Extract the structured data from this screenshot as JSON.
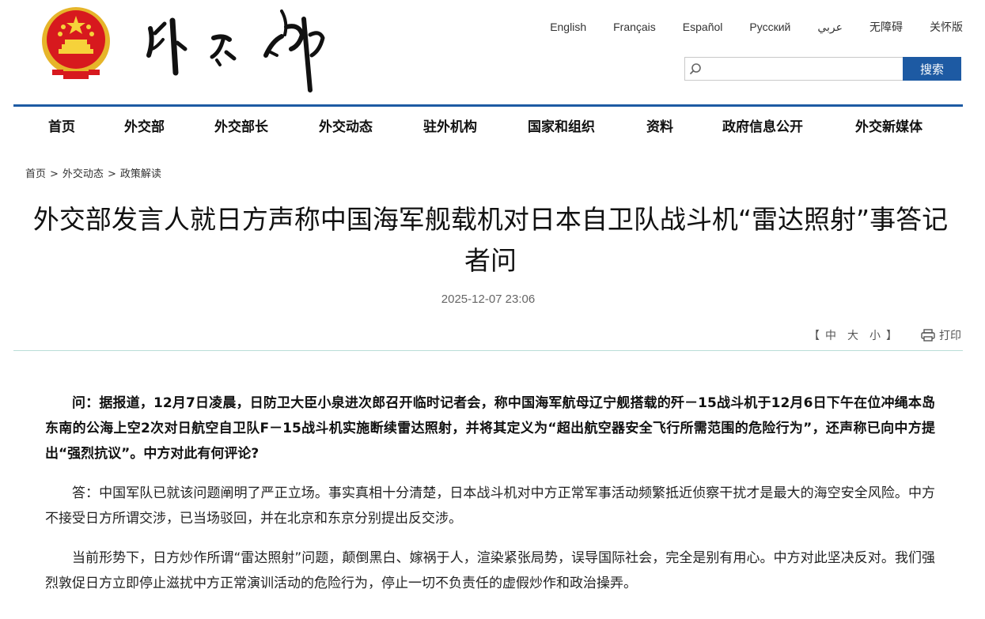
{
  "header": {
    "languages": [
      "English",
      "Français",
      "Español",
      "Русский",
      "عربي",
      "无障碍",
      "关怀版"
    ],
    "search": {
      "placeholder": "",
      "button_label": "搜索"
    }
  },
  "nav": {
    "items": [
      "首页",
      "外交部",
      "外交部长",
      "外交动态",
      "驻外机构",
      "国家和组织",
      "资料",
      "政府信息公开",
      "外交新媒体"
    ]
  },
  "breadcrumb": [
    "首页",
    "外交动态",
    "政策解读"
  ],
  "breadcrumb_sep": ">",
  "article": {
    "title": "外交部发言人就日方声称中国海军舰载机对日本自卫队战斗机“雷达照射”事答记者问",
    "date": "2025-12-07 23:06",
    "font_size": {
      "open": "【",
      "large": "中",
      "medium": "大",
      "small": "小",
      "close": "】"
    },
    "print_label": "打印",
    "paragraphs": [
      "问：据报道，12月7日凌晨，日防卫大臣小泉进次郎召开临时记者会，称中国海军航母辽宁舰搭载的歼－15战斗机于12月6日下午在位冲绳本岛东南的公海上空2次对日航空自卫队F－15战斗机实施断续雷达照射，并将其定义为“超出航空器安全飞行所需范围的危险行为”，还声称已向中方提出“强烈抗议”。中方对此有何评论?",
      "答：中国军队已就该问题阐明了严正立场。事实真相十分清楚，日本战斗机对中方正常军事活动频繁抵近侦察干扰才是最大的海空安全风险。中方不接受日方所谓交涉，已当场驳回，并在北京和东京分别提出反交涉。",
      "当前形势下，日方炒作所谓“雷达照射”问题，颠倒黑白、嫁祸于人，渲染紧张局势，误导国际社会，完全是别有用心。中方对此坚决反对。我们强烈敦促日方立即停止滋扰中方正常演训活动的危险行为，停止一切不负责任的虚假炒作和政治操弄。"
    ]
  },
  "colors": {
    "brand_blue": "#1d5aa3",
    "emblem_red": "#d7191e",
    "emblem_gold": "#f2c12e",
    "divider": "#b9ddd7"
  },
  "icons": [
    "national-emblem-icon",
    "search-icon",
    "printer-icon"
  ]
}
